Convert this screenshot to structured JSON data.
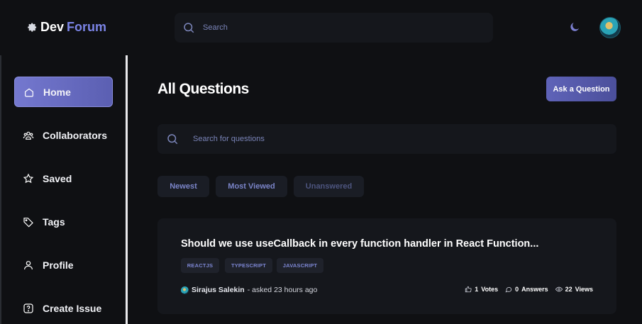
{
  "header": {
    "logo_dev": "Dev",
    "logo_forum": "Forum",
    "search_placeholder": "Search"
  },
  "sidebar": {
    "items": [
      {
        "label": "Home",
        "icon": "home-icon",
        "active": true
      },
      {
        "label": "Collaborators",
        "icon": "users-icon",
        "active": false
      },
      {
        "label": "Saved",
        "icon": "star-icon",
        "active": false
      },
      {
        "label": "Tags",
        "icon": "tag-icon",
        "active": false
      },
      {
        "label": "Profile",
        "icon": "user-icon",
        "active": false
      },
      {
        "label": "Create Issue",
        "icon": "question-icon",
        "active": false
      }
    ]
  },
  "main": {
    "title": "All Questions",
    "ask_button": "Ask a Question",
    "search_placeholder": "Search for questions",
    "filters": [
      "Newest",
      "Most Viewed",
      "Unanswered"
    ]
  },
  "question": {
    "title": "Should we use useCallback in every function handler in React Function...",
    "tags": [
      "REACTJS",
      "TYPESCRIPT",
      "JAVASCRIPT"
    ],
    "author": "Sirajus Salekin",
    "asked": "- asked 23 hours ago",
    "votes_count": "1",
    "votes_label": "Votes",
    "answers_count": "0",
    "answers_label": "Answers",
    "views_count": "22",
    "views_label": "Views"
  },
  "colors": {
    "background": "#0f1013",
    "panel": "#15171c",
    "accent": "#7b84e6",
    "active_nav": "#6a6ec4"
  }
}
